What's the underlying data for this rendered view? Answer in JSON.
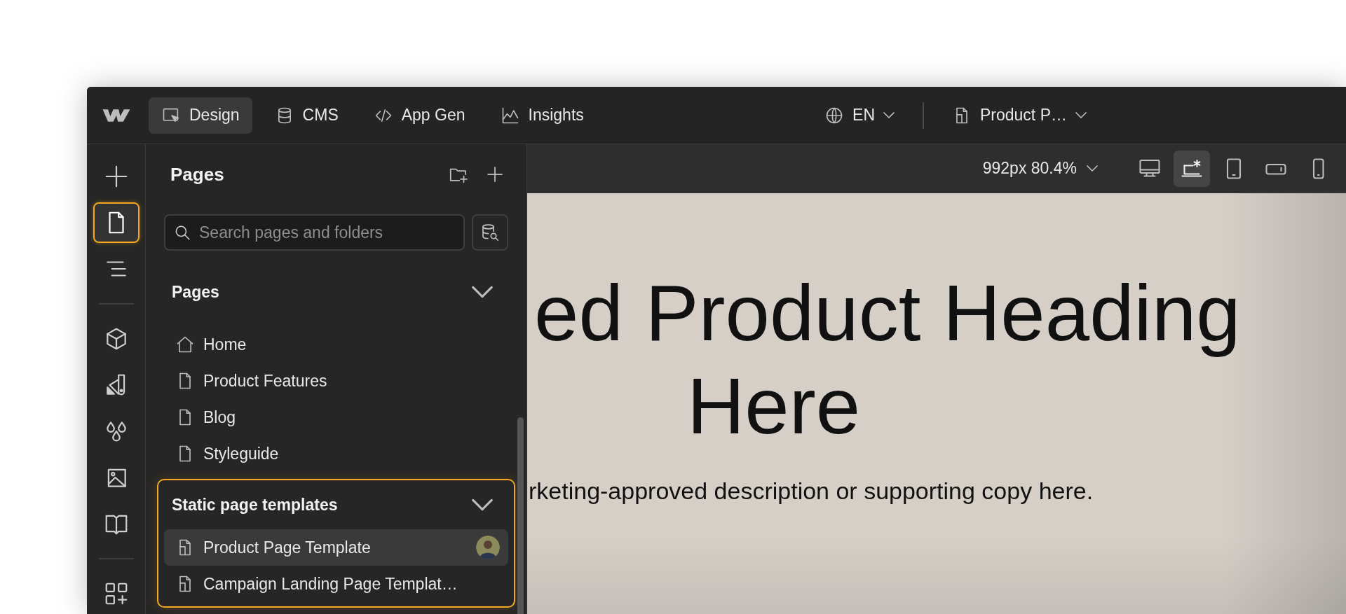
{
  "top_bar": {
    "tabs": [
      {
        "label": "Design",
        "selected": true
      },
      {
        "label": "CMS",
        "selected": false
      },
      {
        "label": "App Gen",
        "selected": false
      },
      {
        "label": "Insights",
        "selected": false
      }
    ],
    "locale": {
      "label": "EN"
    },
    "page_picker": {
      "label": "Product P…"
    }
  },
  "rail": {
    "groups": [
      [
        {
          "selected": false
        },
        {
          "selected": true
        },
        {
          "selected": false
        }
      ],
      [
        {
          "selected": false
        },
        {
          "selected": false
        },
        {
          "selected": false
        },
        {
          "selected": false
        },
        {
          "selected": false
        }
      ],
      [
        {
          "selected": false
        }
      ]
    ]
  },
  "pages_panel": {
    "title": "Pages",
    "search": {
      "placeholder": "Search pages and folders"
    },
    "sections": [
      {
        "title": "Pages",
        "expanded": true,
        "highlighted": false,
        "items": [
          {
            "label": "Home",
            "kind": "home",
            "selected": false,
            "avatar": false
          },
          {
            "label": "Product Features",
            "kind": "page",
            "selected": false,
            "avatar": false
          },
          {
            "label": "Blog",
            "kind": "page",
            "selected": false,
            "avatar": false
          },
          {
            "label": "Styleguide",
            "kind": "page",
            "selected": false,
            "avatar": false
          }
        ]
      },
      {
        "title": "Static page templates",
        "expanded": true,
        "highlighted": true,
        "items": [
          {
            "label": "Product Page Template",
            "kind": "template",
            "selected": true,
            "avatar": true
          },
          {
            "label": "Campaign Landing Page Templat…",
            "kind": "template",
            "selected": false,
            "avatar": false
          }
        ]
      }
    ]
  },
  "canvas_toolbar": {
    "size": "992px 80.4%",
    "breakpoints": [
      {
        "selected": false
      },
      {
        "selected": true
      },
      {
        "selected": false
      },
      {
        "selected": false
      },
      {
        "selected": false
      }
    ]
  },
  "canvas": {
    "heading_lines": [
      "ed Product Heading",
      "Here"
    ],
    "description": "rketing-approved description or supporting copy here."
  }
}
